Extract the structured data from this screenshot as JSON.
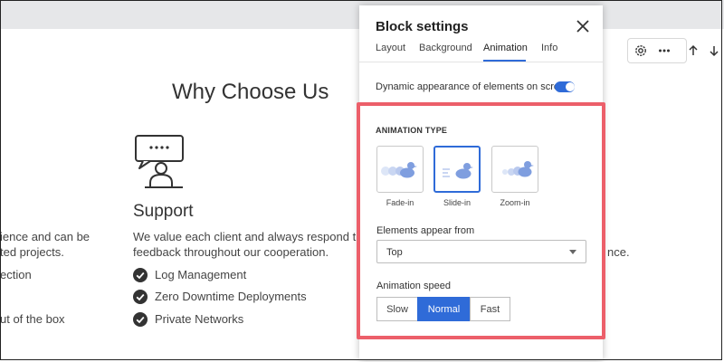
{
  "page": {
    "title": "Why Choose Us",
    "left_partial_lines": [
      "ience and can be",
      "ted projects.",
      "ection",
      "ut of the box"
    ],
    "right_partial_text": "nce.",
    "support": {
      "heading": "Support",
      "description_line1": "We value each client and always respond t",
      "description_line2": "feedback throughout our cooperation.",
      "features": [
        "Log Management",
        "Zero Downtime Deployments",
        "Private Networks"
      ]
    }
  },
  "toolbar": {
    "icons": [
      "gear-icon",
      "more-icon",
      "arrow-up-icon",
      "arrow-down-icon"
    ]
  },
  "panel": {
    "title": "Block settings",
    "tabs": [
      "Layout",
      "Background",
      "Animation",
      "Info"
    ],
    "active_tab": "Animation",
    "toggle_label": "Dynamic appearance of elements on scroll",
    "toggle_on": true,
    "animation_type_label": "ANIMATION TYPE",
    "animation_types": [
      "Fade-in",
      "Slide-in",
      "Zoom-in"
    ],
    "selected_animation": "Slide-in",
    "appear_from_label": "Elements appear from",
    "appear_from_value": "Top",
    "speed_label": "Animation speed",
    "speeds": [
      "Slow",
      "Normal",
      "Fast"
    ],
    "selected_speed": "Normal"
  },
  "colors": {
    "accent": "#2f6bd8",
    "highlight": "#ec5f6a",
    "topbar": "#e6e7e9",
    "icon_light": "#b9c9ee",
    "icon_main": "#7f9edf"
  }
}
